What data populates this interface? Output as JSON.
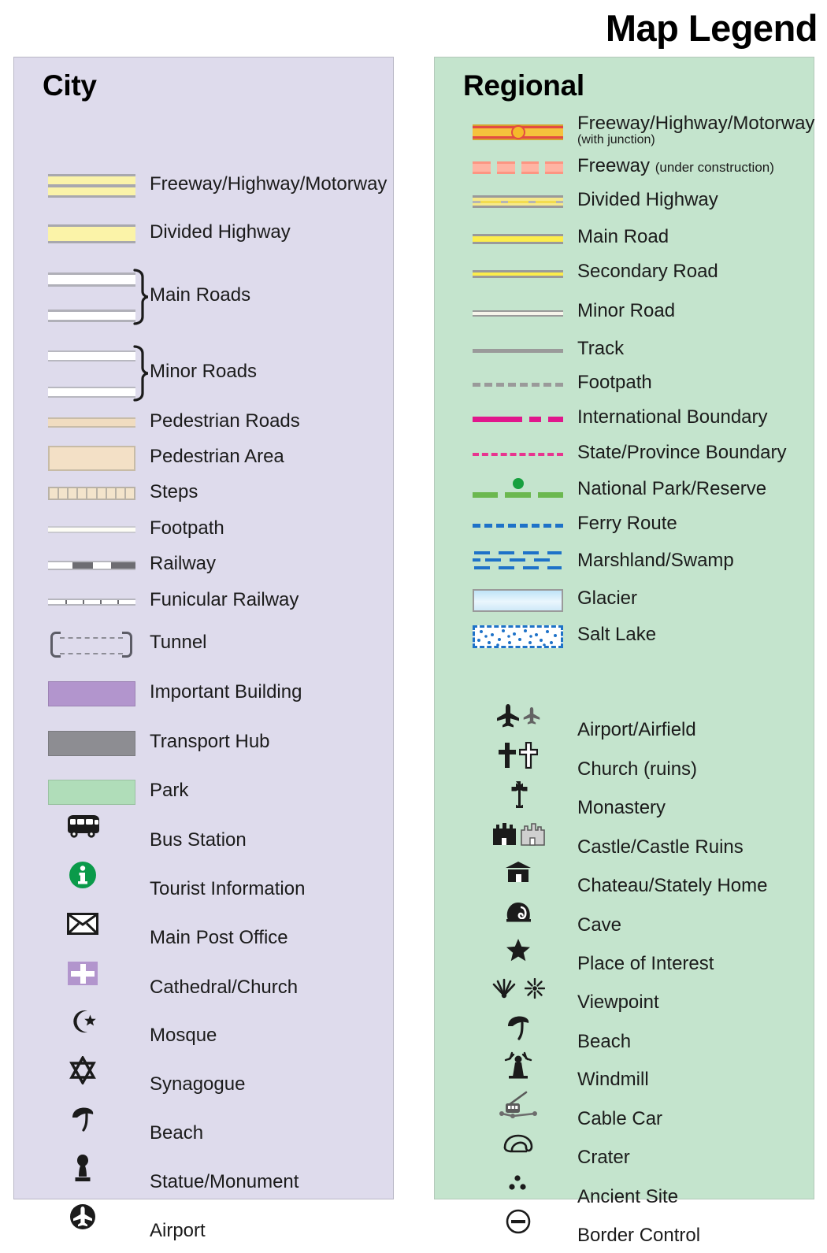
{
  "title": "Map Legend",
  "city": {
    "heading": "City",
    "panel_color": "#dedbec",
    "items": [
      {
        "label": "Freeway/Highway/Motorway",
        "symbol": "freeway-bar",
        "color": "#faf3a9"
      },
      {
        "label": "Divided Highway",
        "symbol": "divided-highway-bar",
        "color": "#fbf3a8"
      },
      {
        "label": "Main Roads",
        "symbol": "main-roads-braced-bars",
        "color": "#ffffff"
      },
      {
        "label": "Minor Roads",
        "symbol": "minor-roads-braced-bars",
        "color": "#ffffff"
      },
      {
        "label": "Pedestrian Roads",
        "symbol": "pedestrian-road-bar",
        "color": "#f0dcc0"
      },
      {
        "label": "Pedestrian Area",
        "symbol": "pedestrian-area-swatch",
        "color": "#f3e0c6"
      },
      {
        "label": "Steps",
        "symbol": "steps-bar",
        "color": "#f3e4cb"
      },
      {
        "label": "Footpath",
        "symbol": "footpath-bar",
        "color": "#fdfdf5"
      },
      {
        "label": "Railway",
        "symbol": "railway-bar",
        "color": "#6d6d72"
      },
      {
        "label": "Funicular Railway",
        "symbol": "funicular-railway-bar",
        "color": "#6d6d72"
      },
      {
        "label": "Tunnel",
        "symbol": "tunnel-bracket-symbol",
        "color": "#5c5c66"
      },
      {
        "label": "Important Building",
        "symbol": "important-building-swatch",
        "color": "#b295cd"
      },
      {
        "label": "Transport Hub",
        "symbol": "transport-hub-swatch",
        "color": "#8d8d92"
      },
      {
        "label": "Park",
        "symbol": "park-swatch",
        "color": "#b0ddb9"
      },
      {
        "label": "Bus Station",
        "symbol": "bus-icon",
        "color": "#1b1b1b"
      },
      {
        "label": "Tourist Information",
        "symbol": "information-circle-icon",
        "color": "#0a9a4a"
      },
      {
        "label": "Main Post Office",
        "symbol": "envelope-icon",
        "color": "#1b1b1b"
      },
      {
        "label": "Cathedral/Church",
        "symbol": "church-cross-icon",
        "color": "#b295cd"
      },
      {
        "label": "Mosque",
        "symbol": "star-and-crescent-icon",
        "color": "#1b1b1b"
      },
      {
        "label": "Synagogue",
        "symbol": "star-of-david-icon",
        "color": "#1b1b1b"
      },
      {
        "label": "Beach",
        "symbol": "beach-umbrella-icon",
        "color": "#1b1b1b"
      },
      {
        "label": "Statue/Monument",
        "symbol": "statue-icon",
        "color": "#1b1b1b"
      },
      {
        "label": "Airport",
        "symbol": "airport-circle-icon",
        "color": "#1b1b1b"
      }
    ]
  },
  "regional": {
    "heading": "Regional",
    "panel_color": "#c4e4cd",
    "items": [
      {
        "label": "Freeway/Highway/Motorway",
        "sublabel": "(with junction)",
        "symbol": "freeway-with-junction",
        "color": "#e34b42"
      },
      {
        "label": "Freeway",
        "sublabel": "(under construction)",
        "symbol": "freeway-under-construction",
        "color": "#ffb4a3"
      },
      {
        "label": "Divided Highway",
        "symbol": "divided-highway-line",
        "color": "#f6e98a"
      },
      {
        "label": "Main Road",
        "symbol": "main-road-line",
        "color": "#fced4c"
      },
      {
        "label": "Secondary Road",
        "symbol": "secondary-road-line",
        "color": "#fced4c"
      },
      {
        "label": "Minor Road",
        "symbol": "minor-road-line",
        "color": "#f6f4ea"
      },
      {
        "label": "Track",
        "symbol": "track-line",
        "color": "#9a9a9a"
      },
      {
        "label": "Footpath",
        "symbol": "footpath-dashed-line",
        "color": "#9a9a9a"
      },
      {
        "label": "International Boundary",
        "symbol": "international-boundary-line",
        "color": "#e0178c"
      },
      {
        "label": "State/Province Boundary",
        "symbol": "state-boundary-line",
        "color": "#e8348f"
      },
      {
        "label": "National Park/Reserve",
        "symbol": "national-park-line",
        "color": "#6bb84f"
      },
      {
        "label": "Ferry Route",
        "symbol": "ferry-route-line",
        "color": "#1e72c8"
      },
      {
        "label": "Marshland/Swamp",
        "symbol": "marshland-pattern",
        "color": "#1e72c8"
      },
      {
        "label": "Glacier",
        "symbol": "glacier-swatch",
        "color": "#bfe3f7"
      },
      {
        "label": "Salt Lake",
        "symbol": "salt-lake-swatch",
        "color": "#1e72c8"
      },
      {
        "label": "Airport/Airfield",
        "symbol": "airplane-icons",
        "color": "#1b1b1b"
      },
      {
        "label": "Church (ruins)",
        "symbol": "church-ruins-cross-icons",
        "color": "#1b1b1b"
      },
      {
        "label": "Monastery",
        "symbol": "monastery-cross-icon",
        "color": "#1b1b1b"
      },
      {
        "label": "Castle/Castle Ruins",
        "symbol": "castle-icons",
        "color": "#1b1b1b"
      },
      {
        "label": "Chateau/Stately Home",
        "symbol": "chateau-icon",
        "color": "#1b1b1b"
      },
      {
        "label": "Cave",
        "symbol": "cave-icon",
        "color": "#1b1b1b"
      },
      {
        "label": "Place of Interest",
        "symbol": "star-icon",
        "color": "#1b1b1b"
      },
      {
        "label": "Viewpoint",
        "symbol": "viewpoint-icons",
        "color": "#1b1b1b"
      },
      {
        "label": "Beach",
        "symbol": "beach-umbrella-icon",
        "color": "#1b1b1b"
      },
      {
        "label": "Windmill",
        "symbol": "windmill-icon",
        "color": "#1b1b1b"
      },
      {
        "label": "Cable Car",
        "symbol": "cable-car-icon",
        "color": "#4a4a4a"
      },
      {
        "label": "Crater",
        "symbol": "crater-icon",
        "color": "#1b1b1b"
      },
      {
        "label": "Ancient Site",
        "symbol": "ancient-site-dots-icon",
        "color": "#1b1b1b"
      },
      {
        "label": "Border Control",
        "symbol": "border-control-icon",
        "color": "#1b1b1b"
      }
    ]
  }
}
